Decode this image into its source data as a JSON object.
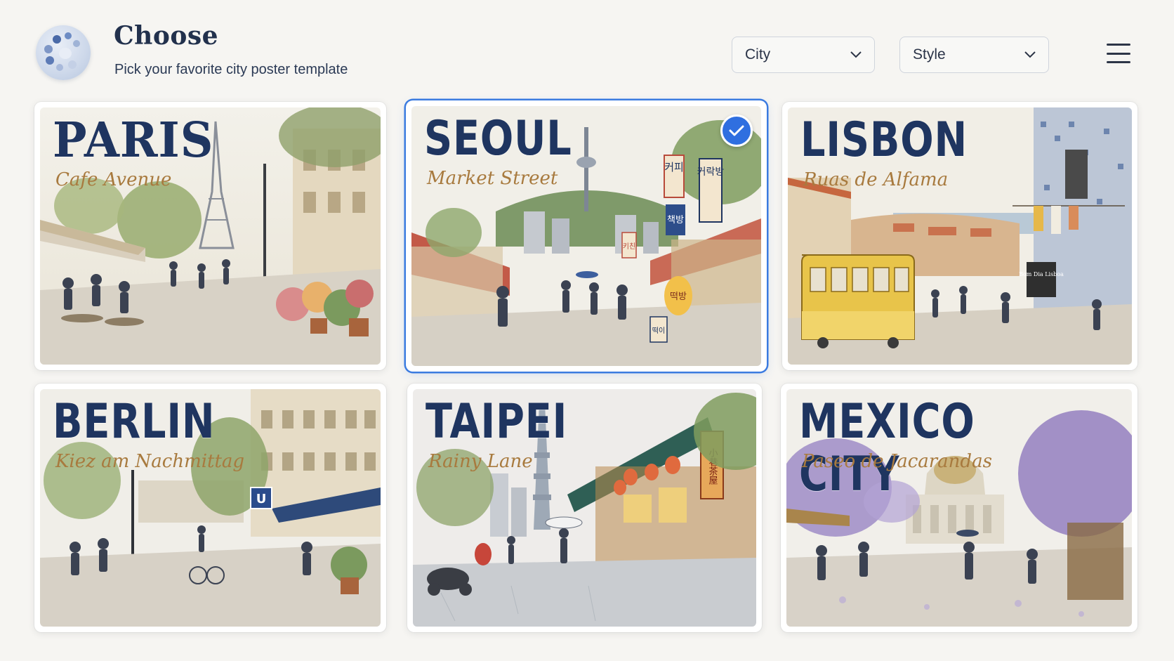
{
  "header": {
    "title": "Choose",
    "subtitle": "Pick your favorite city poster template"
  },
  "filters": {
    "city_label": "City",
    "style_label": "Style"
  },
  "colors": {
    "accent": "#2f6fe0",
    "title_navy": "#1f3560",
    "tagline_gold": "#a87a3e"
  },
  "posters": [
    {
      "city": "PARIS",
      "tagline": "Cafe Avenue",
      "selected": false
    },
    {
      "city": "SEOUL",
      "tagline": "Market Street",
      "selected": true
    },
    {
      "city": "LISBON",
      "tagline": "Ruas de Alfama",
      "selected": false
    },
    {
      "city": "BERLIN",
      "tagline": "Kiez am Nachmittag",
      "selected": false
    },
    {
      "city": "TAIPEI",
      "tagline": "Rainy Lane",
      "selected": false
    },
    {
      "city": "MEXICO CITY",
      "tagline": "Paseo de Jacarandas",
      "selected": false
    }
  ],
  "scene_text": {
    "seoul_signs": [
      "커피",
      "커락방",
      "책방",
      "떡방",
      "키친",
      "떡이"
    ],
    "lisbon_sign": "Bom Dia Lisboa",
    "berlin_sign": "U",
    "taipei_sign": "小巷茶屋"
  }
}
